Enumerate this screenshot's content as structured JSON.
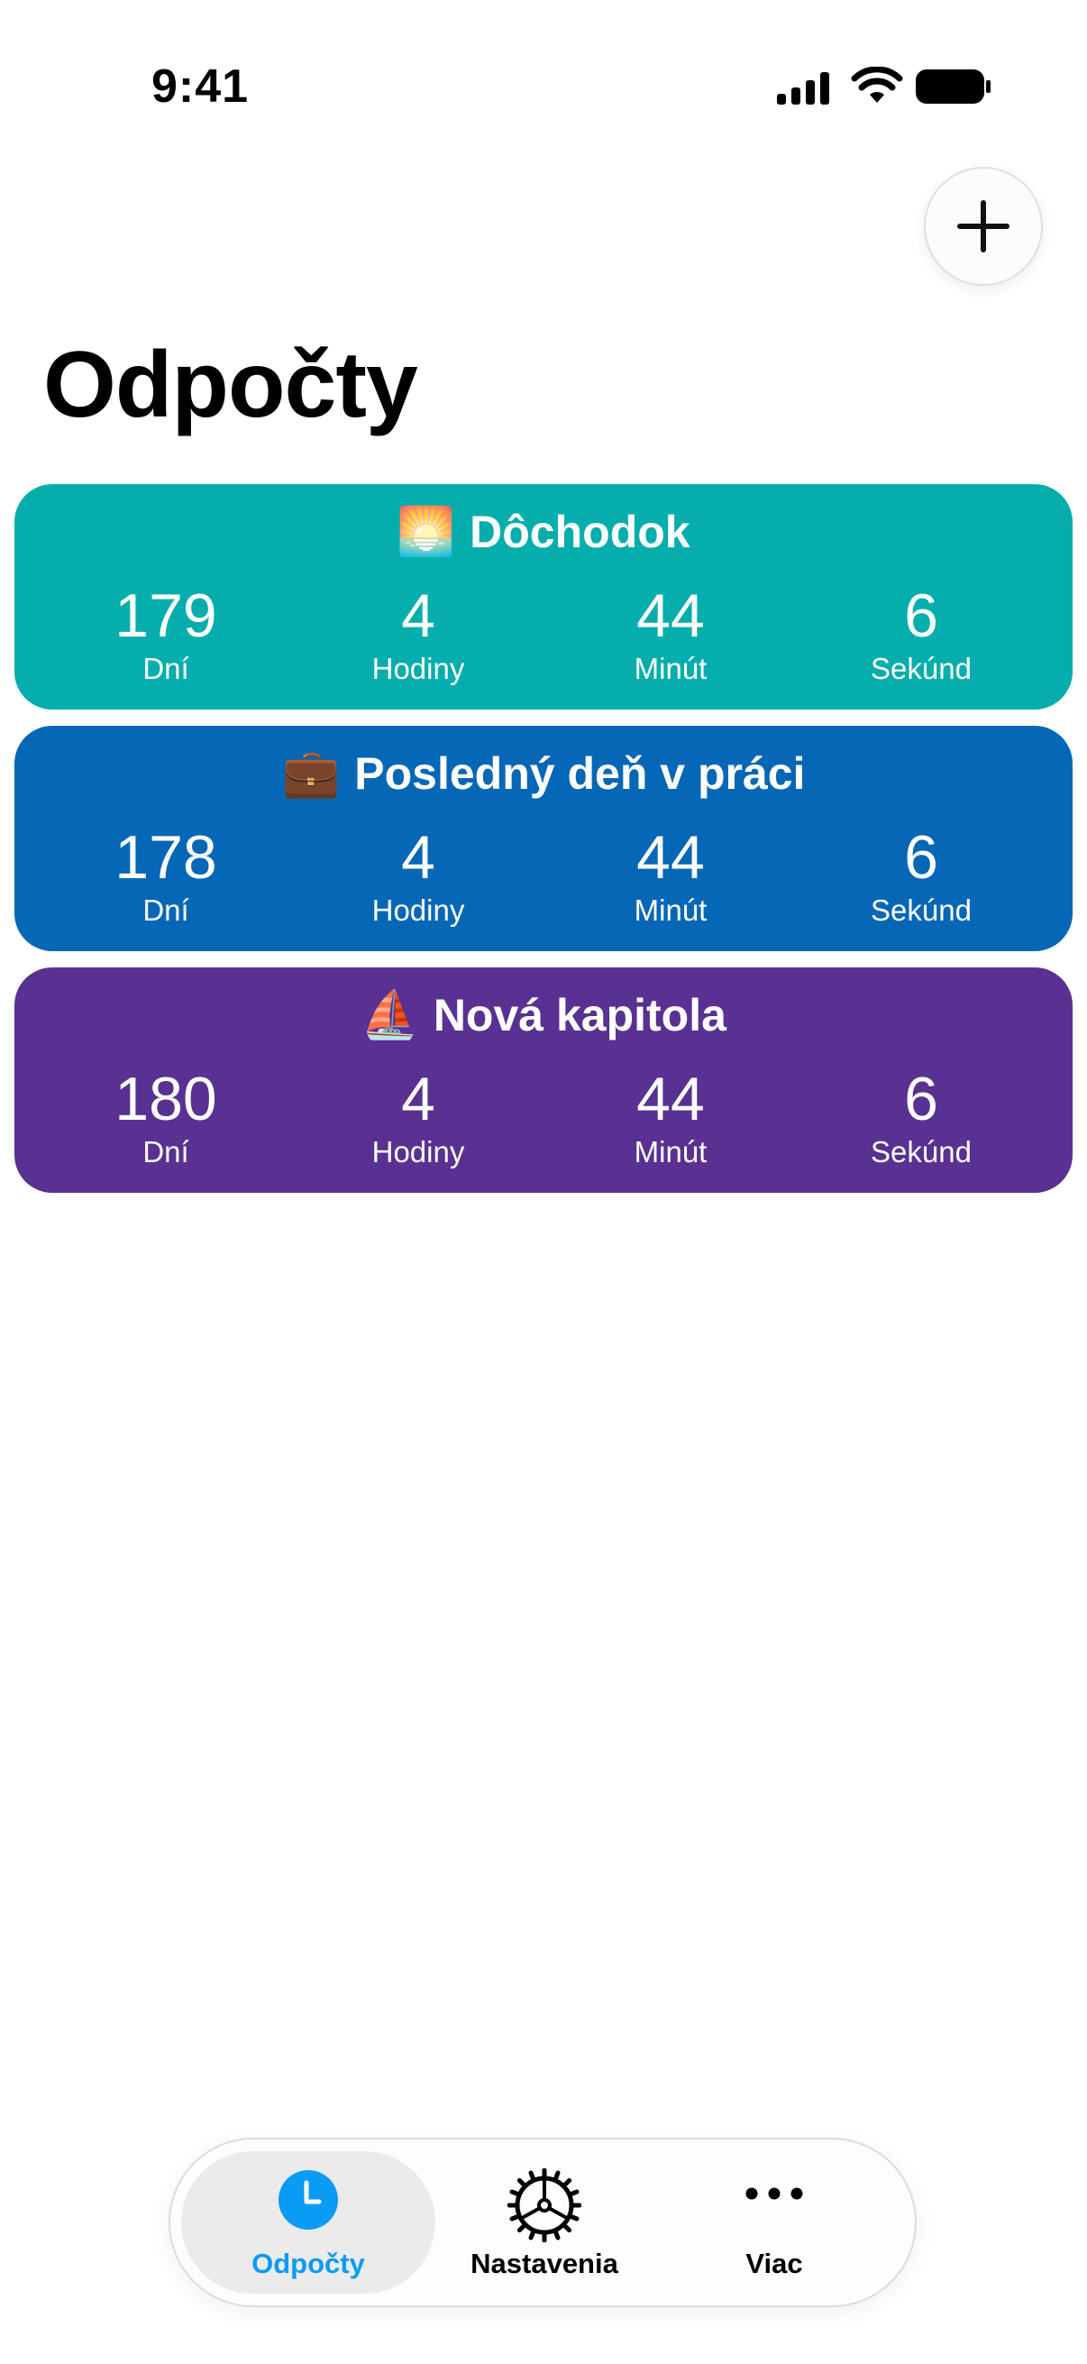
{
  "status_bar": {
    "time": "9:41"
  },
  "header": {
    "title": "Odpočty"
  },
  "countdowns": [
    {
      "emoji": "🌅",
      "title": "Dôchodok",
      "color": "#05AEAC",
      "units": [
        {
          "value": "179",
          "label": "Dní"
        },
        {
          "value": "4",
          "label": "Hodiny"
        },
        {
          "value": "44",
          "label": "Minút"
        },
        {
          "value": "6",
          "label": "Sekúnd"
        }
      ]
    },
    {
      "emoji": "💼",
      "title": "Posledný deň v práci",
      "color": "#0767B7",
      "units": [
        {
          "value": "178",
          "label": "Dní"
        },
        {
          "value": "4",
          "label": "Hodiny"
        },
        {
          "value": "44",
          "label": "Minút"
        },
        {
          "value": "6",
          "label": "Sekúnd"
        }
      ]
    },
    {
      "emoji": "⛵",
      "title": "Nová kapitola",
      "color": "#583192",
      "units": [
        {
          "value": "180",
          "label": "Dní"
        },
        {
          "value": "4",
          "label": "Hodiny"
        },
        {
          "value": "44",
          "label": "Minút"
        },
        {
          "value": "6",
          "label": "Sekúnd"
        }
      ]
    }
  ],
  "tabbar": {
    "accent_color": "#0A9BF5",
    "tabs": [
      {
        "label": "Odpočty",
        "icon": "clock-icon",
        "active": true
      },
      {
        "label": "Nastavenia",
        "icon": "gear-icon",
        "active": false
      },
      {
        "label": "Viac",
        "icon": "ellipsis-icon",
        "active": false
      }
    ]
  }
}
